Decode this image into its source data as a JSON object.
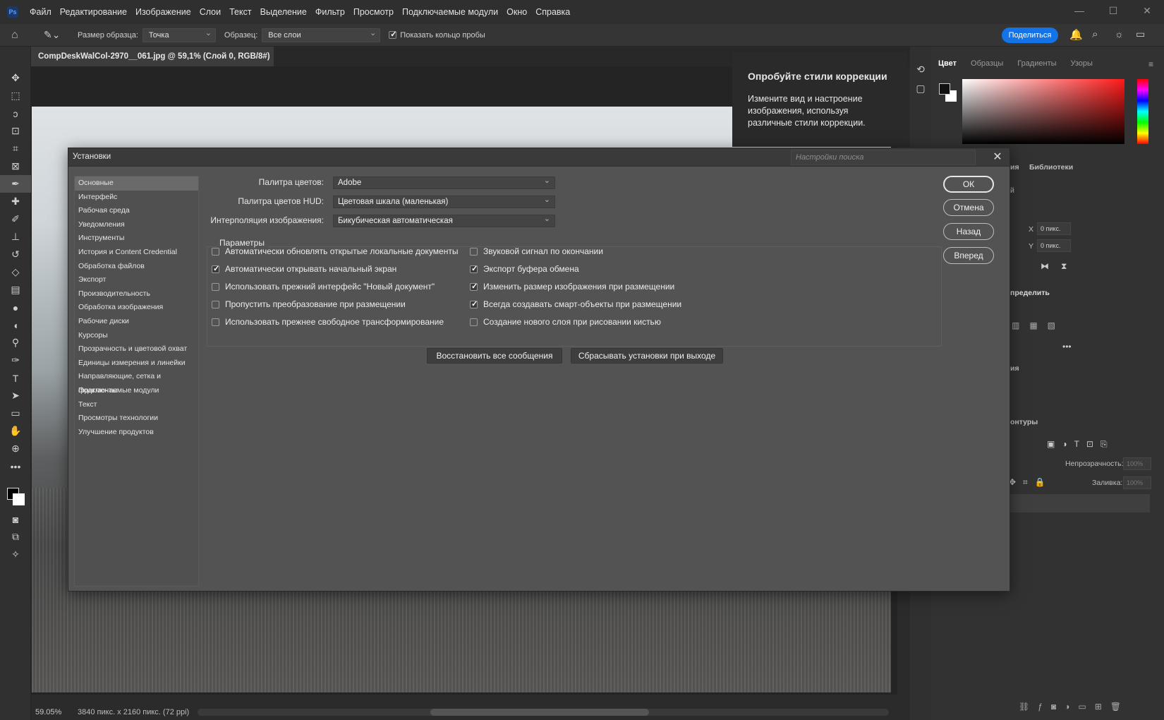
{
  "app": {
    "logo": "Ps",
    "menu": [
      "Файл",
      "Редактирование",
      "Изображение",
      "Слои",
      "Текст",
      "Выделение",
      "Фильтр",
      "Просмотр",
      "Подключаемые модули",
      "Окно",
      "Справка"
    ],
    "window_controls": [
      "—",
      "☐",
      "✕"
    ]
  },
  "options_bar": {
    "sample_size_label": "Размер образца:",
    "sample_size_value": "Точка",
    "sample_label": "Образец:",
    "sample_value": "Все слои",
    "show_ring_label": "Показать кольцо пробы",
    "show_ring_checked": true,
    "share_label": "Поделиться"
  },
  "document": {
    "tab_title": "CompDeskWalCol-2970__061.jpg @ 59,1% (Слой 0, RGB/8#) *",
    "close": "×",
    "zoom": "59.05%",
    "size_info": "3840 пикс. x 2160 пикс. (72 ppi)"
  },
  "tip": {
    "title": "Опробуйте стили коррекции",
    "body": "Измените вид и настроение изображения, используя различные стили коррекции."
  },
  "right_panel": {
    "color_tabs": [
      "Цвет",
      "Образцы",
      "Градиенты",
      "Узоры"
    ],
    "libraries_tab": "Библиотеки",
    "partial_ya": "ия",
    "partial_y": "й",
    "x_label": "X",
    "x_value": "0 пикс.",
    "y_label": "Y",
    "y_value": "0 пикс.",
    "define": "пределить",
    "partial_iya2": "ия",
    "contours": "онтуры",
    "opacity_label": "Непрозрачность:",
    "opacity_value": "100%",
    "fill_label": "Заливка:",
    "fill_value": "100%"
  },
  "dialog": {
    "title": "Установки",
    "search_placeholder": "Настройки поиска",
    "close": "✕",
    "nav": [
      "Основные",
      "Интерфейс",
      "Рабочая среда",
      "Уведомления",
      "Инструменты",
      "История и Content Credential",
      "Обработка файлов",
      "Экспорт",
      "Производительность",
      "Обработка изображения",
      "Рабочие диски",
      "Курсоры",
      "Прозрачность и цветовой охват",
      "Единицы измерения и линейки",
      "Направляющие, сетка и фрагменты",
      "Подключаемые модули",
      "Текст",
      "Просмотры технологии",
      "Улучшение продуктов"
    ],
    "color_picker_label": "Палитра цветов:",
    "color_picker_value": "Adobe",
    "hud_label": "Палитра цветов HUD:",
    "hud_value": "Цветовая шкала (маленькая)",
    "interp_label": "Интерполяция изображения:",
    "interp_value": "Бикубическая автоматическая",
    "params_label": "Параметры",
    "options_left": [
      {
        "label": "Автоматически обновлять открытые локальные документы",
        "checked": false
      },
      {
        "label": "Автоматически открывать начальный экран",
        "checked": true
      },
      {
        "label": "Использовать прежний интерфейс \"Новый документ\"",
        "checked": false
      },
      {
        "label": "Пропустить преобразование при размещении",
        "checked": false
      },
      {
        "label": "Использовать прежнее свободное трансформирование",
        "checked": false
      }
    ],
    "options_right": [
      {
        "label": "Звуковой сигнал по окончании",
        "checked": false
      },
      {
        "label": "Экспорт буфера обмена",
        "checked": true
      },
      {
        "label": "Изменить размер изображения при размещении",
        "checked": true
      },
      {
        "label": "Всегда создавать смарт-объекты при размещении",
        "checked": true
      },
      {
        "label": "Создание нового слоя при рисовании кистью",
        "checked": false
      }
    ],
    "reset_messages": "Восстановить все сообщения",
    "reset_on_exit": "Сбрасывать установки при выходе",
    "ok": "ОК",
    "cancel": "Отмена",
    "back": "Назад",
    "forward": "Вперед"
  }
}
